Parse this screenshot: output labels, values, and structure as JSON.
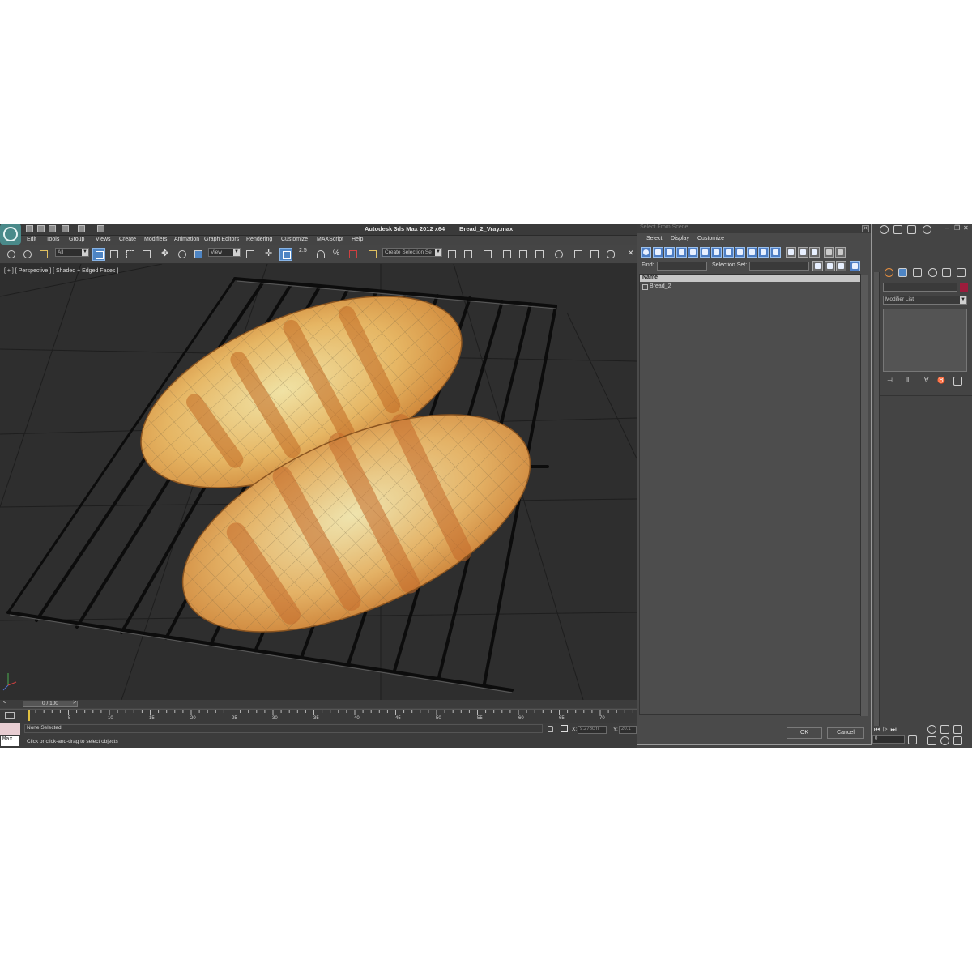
{
  "window": {
    "title": "Autodesk 3ds Max  2012 x64",
    "file": "Bread_2_Vray.max"
  },
  "menu": [
    "Edit",
    "Tools",
    "Group",
    "Views",
    "Create",
    "Modifiers",
    "Animation",
    "Graph Editors",
    "Rendering",
    "Customize",
    "MAXScript",
    "Help"
  ],
  "toolbar": {
    "filter_dropdown": "All",
    "refcoord_dropdown": "View",
    "snap_label": "2.5",
    "selection_set_placeholder": "Create Selection Se"
  },
  "viewport": {
    "label": "[ + ] [ Perspective ] [ Shaded + Edged Faces ]",
    "objects": [
      "bread-loaf",
      "bread-loaf",
      "cooling-rack"
    ]
  },
  "timeline": {
    "frame_display": "0 / 100",
    "ruler_ticks": [
      "5",
      "10",
      "15",
      "20",
      "25",
      "30",
      "35",
      "40",
      "45",
      "50",
      "55",
      "60",
      "65",
      "70"
    ]
  },
  "status": {
    "selection": "None Selected",
    "prompt": "Click or click-and-drag to select objects",
    "x_label": "X:",
    "x_value": "9.278cm",
    "y_label": "Y:",
    "y_value": "20.1",
    "maxscript_label": "Max",
    "frame_field": "0"
  },
  "dialog": {
    "title": "Select From Scene",
    "menu": [
      "Select",
      "Display",
      "Customize"
    ],
    "find_label": "Find:",
    "selection_set_label": "Selection Set:",
    "column_name": "Name",
    "items": [
      "Bread_2"
    ],
    "ok_label": "OK",
    "cancel_label": "Cancel"
  },
  "command_panel": {
    "modifier_list": "Modifier List",
    "object_color": "#9c1c3c"
  },
  "colors": {
    "ui_background": "#444444",
    "viewport_background": "#2e2e2e",
    "accent": "#4e85c4",
    "bread_crust": "#d99240",
    "bread_crumb": "#ece2a8"
  }
}
